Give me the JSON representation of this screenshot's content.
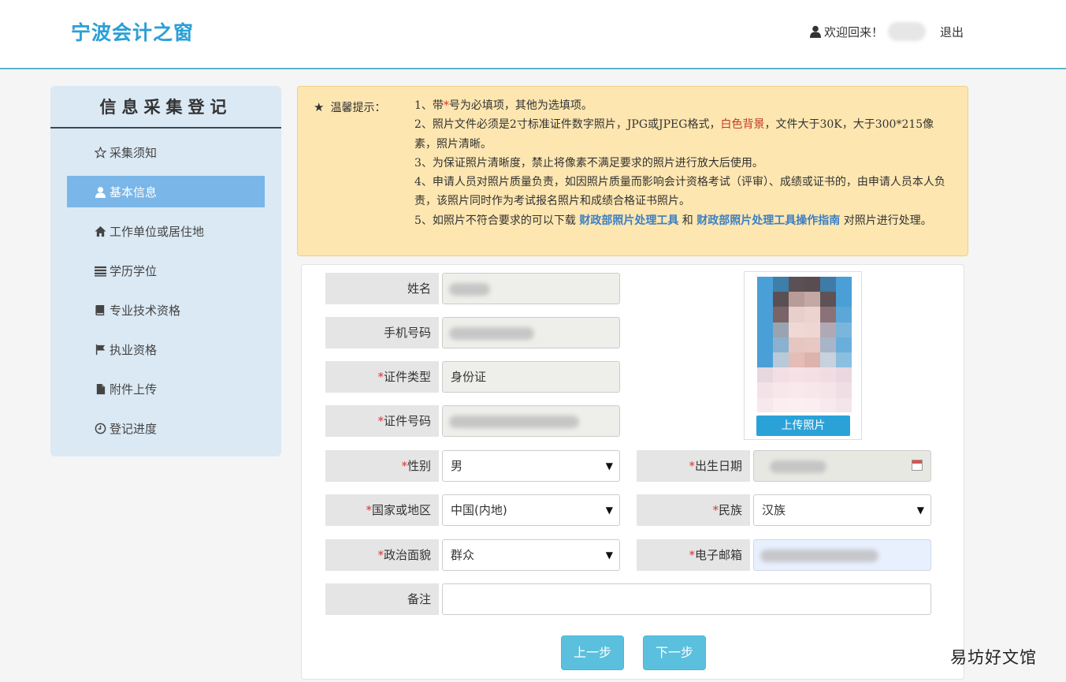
{
  "header": {
    "logo": "宁波会计之窗",
    "welcome": "欢迎回来！",
    "logout": "退出"
  },
  "sidebar": {
    "title": "信息采集登记",
    "items": [
      {
        "label": "采集须知",
        "icon": "star-outline-icon",
        "active": false
      },
      {
        "label": "基本信息",
        "icon": "user-icon",
        "active": true
      },
      {
        "label": "工作单位或居住地",
        "icon": "home-icon",
        "active": false
      },
      {
        "label": "学历学位",
        "icon": "list-icon",
        "active": false
      },
      {
        "label": "专业技术资格",
        "icon": "book-icon",
        "active": false
      },
      {
        "label": "执业资格",
        "icon": "flag-icon",
        "active": false
      },
      {
        "label": "附件上传",
        "icon": "file-icon",
        "active": false
      },
      {
        "label": "登记进度",
        "icon": "clock-icon",
        "active": false
      }
    ]
  },
  "notice": {
    "label": "温馨提示：",
    "line1_a": "1、带",
    "line1_star": "*",
    "line1_b": "号为必填项，其他为选填项。",
    "line2_a": "2、照片文件必须是2寸标准证件数字照片，JPG或JPEG格式，",
    "line2_red": "白色背景",
    "line2_b": "，文件大于30K，大于300*215像素，照片清晰。",
    "line3": "3、为保证照片清晰度，禁止将像素不满足要求的照片进行放大后使用。",
    "line4": "4、申请人员对照片质量负责，如因照片质量而影响会计资格考试（评审）、成绩或证书的，由申请人员本人负责，该照片同时作为考试报名照片和成绩合格证书照片。",
    "line5_a": "5、如照片不符合要求的可以下载 ",
    "link1": "财政部照片处理工具",
    "line5_and": " 和 ",
    "link2": "财政部照片处理工具操作指南",
    "line5_b": " 对照片进行处理。"
  },
  "form": {
    "name_label": "姓名",
    "phone_label": "手机号码",
    "id_type_label": "证件类型",
    "id_type_value": "身份证",
    "id_number_label": "证件号码",
    "gender_label": "性别",
    "gender_value": "男",
    "birth_label": "出生日期",
    "region_label": "国家或地区",
    "region_value": "中国(内地)",
    "ethnic_label": "民族",
    "ethnic_value": "汉族",
    "politics_label": "政治面貌",
    "politics_value": "群众",
    "email_label": "电子邮箱",
    "remark_label": "备注",
    "required_mark": "*",
    "upload_photo": "上传照片",
    "prev": "上一步",
    "next": "下一步"
  },
  "watermark": "易坊好文馆"
}
